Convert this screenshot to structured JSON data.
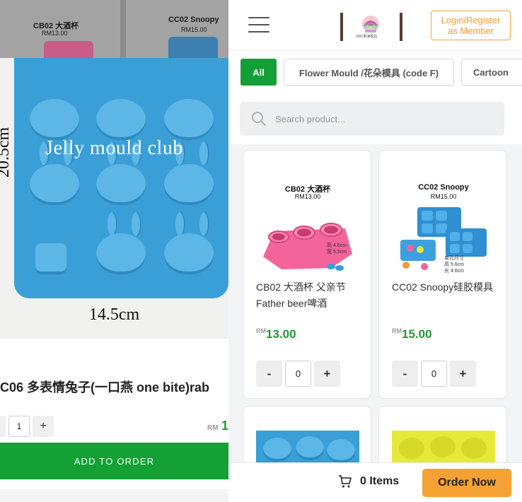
{
  "left": {
    "peek_cards": [
      {
        "title": "CB02 大酒杯",
        "price": "RM13.00"
      },
      {
        "title": "CC02 Snoopy",
        "price": "RM15.00"
      }
    ],
    "hero": {
      "watermark": "Jelly mould club",
      "dim_width": "14.5cm",
      "dim_height": "20.5cm"
    },
    "product_title": "C06 多表情兔子(一口燕 one bite)rab",
    "quantity": "1",
    "qty_minus": "-",
    "qty_plus": "+",
    "price_currency": "RM",
    "price_amount": "1",
    "add_button": "ADD TO ORDER"
  },
  "header": {
    "logo_text": "JMC果凍模具",
    "login_label_line1": "Login/Register",
    "login_label_line2": "as Member"
  },
  "categories": [
    {
      "label": "All",
      "active": true
    },
    {
      "label": "Flower Mould /花朵模具 (code F)",
      "active": false
    },
    {
      "label": "Cartoon",
      "active": false
    }
  ],
  "search": {
    "placeholder": "Search product..."
  },
  "products": [
    {
      "img_title": "CB02 大酒杯",
      "img_price": "RM13.00",
      "img_note": "高 4.6cm\n宽 5.5cm",
      "name": "CB02 大酒杯 父亲节 Father beer啤酒",
      "currency": "RM",
      "price": "13.00",
      "qty": "0",
      "minus": "-",
      "plus": "+"
    },
    {
      "img_title": "CC02 Snoopy",
      "img_price": "RM15.00",
      "img_note": "单孔尺寸\n高 5.6cm\n长 4.6cm",
      "name": "CC02 Snoopy硅胶模具",
      "currency": "RM",
      "price": "15.00",
      "qty": "0",
      "minus": "-",
      "plus": "+"
    }
  ],
  "footer": {
    "cart_label": "0 Items",
    "order_button": "Order Now"
  },
  "colors": {
    "green": "#13a035",
    "price_green": "#1e9b37",
    "orange": "#f5a133",
    "mould_blue": "#3a9fd6",
    "mould_pink": "#f2649a",
    "mould_yellow": "#e6e83a"
  }
}
